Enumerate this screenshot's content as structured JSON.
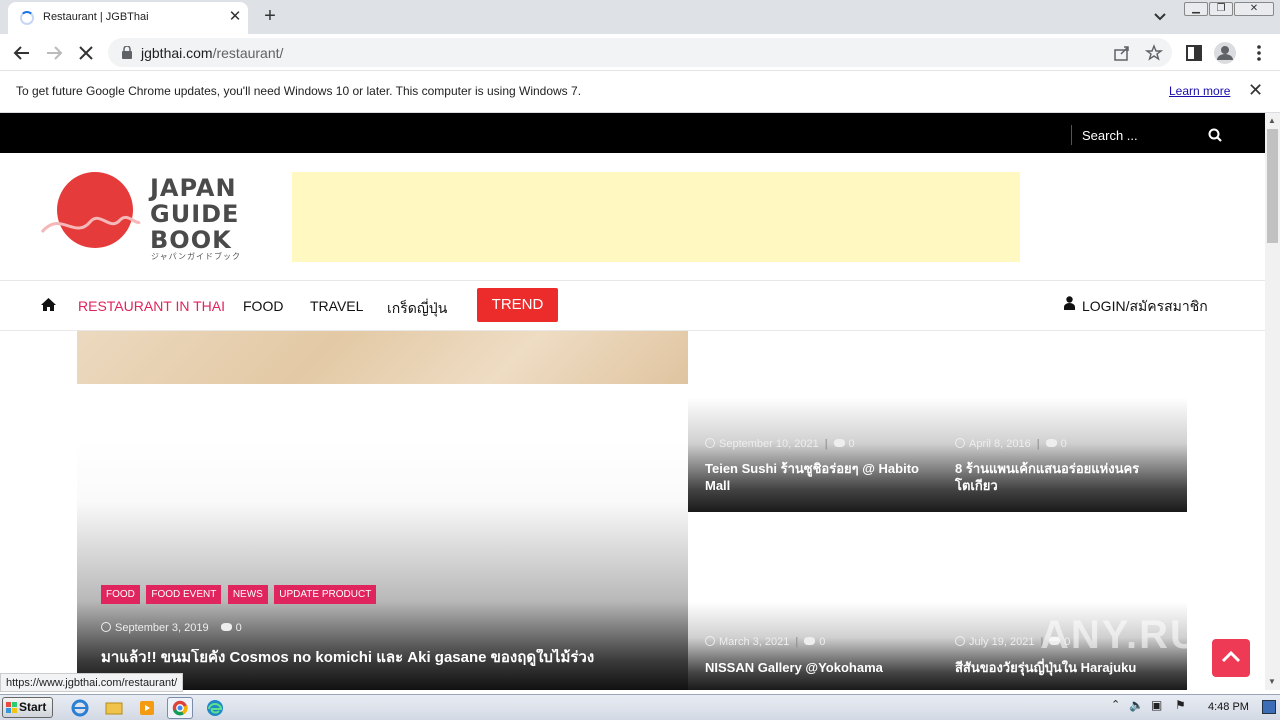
{
  "browser": {
    "tab_title": "Restaurant | JGBThai",
    "url_host": "jgbthai.com",
    "url_path": "/restaurant/",
    "infobar_text": "To get future Google Chrome updates, you'll need Windows 10 or later. This computer is using Windows 7.",
    "learn_more": "Learn more",
    "status_url": "https://www.jgbthai.com/restaurant/"
  },
  "site": {
    "search_placeholder": "Search ...",
    "logo_lines": [
      "JAPAN",
      "GUIDE",
      "BOOK"
    ],
    "logo_sub": "ジャパンガイドブック",
    "nav": {
      "restaurant": "RESTAURANT IN THAI",
      "food": "FOOD",
      "travel": "TRAVEL",
      "trivia": "เกร็ดญี่ปุ่น",
      "trend": "TREND",
      "login": "LOGIN/สมัครสมาชิก"
    },
    "featured": {
      "tags": [
        "FOOD",
        "FOOD EVENT",
        "NEWS",
        "UPDATE PRODUCT"
      ],
      "date": "September 3, 2019",
      "comments": "0",
      "title": "มาแล้ว!! ขนมโยคัง Cosmos no komichi และ Aki gasane ของฤดูใบไม้ร่วง"
    },
    "cards": [
      {
        "date": "September 10, 2021",
        "comments": "0",
        "title": "Teien Sushi ร้านซูชิอร่อยๆ @ Habito Mall"
      },
      {
        "date": "April 8, 2016",
        "comments": "0",
        "title": "8 ร้านแพนเค้กแสนอร่อยแห่งนครโตเกียว"
      },
      {
        "date": "March 3, 2021",
        "comments": "0",
        "title": "NISSAN Gallery @Yokohama"
      },
      {
        "date": "July 19, 2021",
        "comments": "0",
        "title": "สีสันของวัยรุ่นญี่ปุ่นใน Harajuku"
      }
    ],
    "watermark": "ANY.RUN"
  },
  "taskbar": {
    "start": "Start",
    "clock": "4:48 PM"
  },
  "colors": {
    "accent": "#e0245e",
    "trend": "#ec2b2b",
    "logo_red": "#e63b3b",
    "ad_bg": "#fff8c1"
  }
}
